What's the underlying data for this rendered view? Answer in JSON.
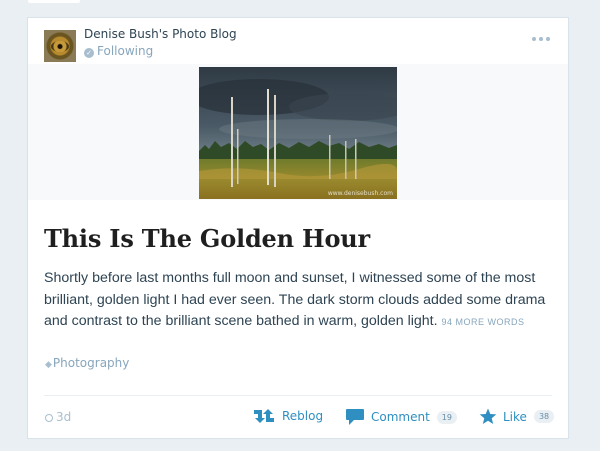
{
  "header": {
    "blog_name": "Denise Bush's Photo Blog",
    "following_label": "Following"
  },
  "post": {
    "image_watermark": "www.denisebush.com",
    "title": "This Is The Golden Hour",
    "excerpt": "Shortly before last months full moon and sunset, I witnessed some of the most brilliant, golden light I had ever seen. The dark storm clouds added some drama and contrast to the brilliant scene bathed in warm, golden light.",
    "more_words": "94 MORE WORDS",
    "tag": "Photography"
  },
  "footer": {
    "time": "3d",
    "reblog_label": "Reblog",
    "comment_label": "Comment",
    "comment_count": "19",
    "like_label": "Like",
    "like_count": "38"
  },
  "colors": {
    "background": "#e9eff3",
    "accent": "#2e8fc0",
    "muted": "#87a6bc",
    "text": "#2e4453"
  },
  "icons": [
    "check-icon",
    "more-icon",
    "tag-icon",
    "clock-icon",
    "reblog-icon",
    "comment-icon",
    "star-icon"
  ]
}
